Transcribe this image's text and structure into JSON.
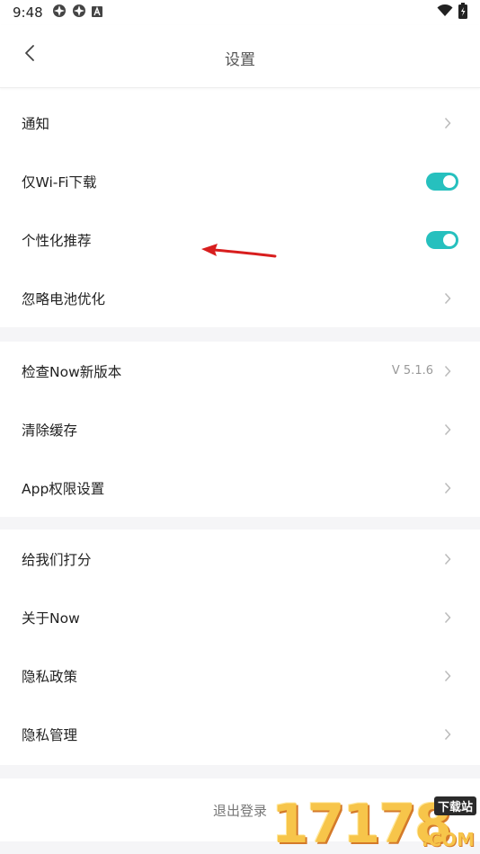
{
  "status_bar": {
    "time": "9:48",
    "icons": [
      "app-icon",
      "app-icon",
      "a-notification-icon"
    ],
    "right_icons": [
      "wifi-icon",
      "battery-icon"
    ]
  },
  "header": {
    "title": "设置",
    "back_icon": "back-chevron-icon"
  },
  "groups": [
    {
      "rows": [
        {
          "label": "通知",
          "trailing": "chevron"
        },
        {
          "label": "仅Wi-Fi下载",
          "trailing": "toggle",
          "on": true
        },
        {
          "label": "个性化推荐",
          "trailing": "toggle",
          "on": true
        },
        {
          "label": "忽略电池优化",
          "trailing": "chevron"
        }
      ]
    },
    {
      "rows": [
        {
          "label": "检查Now新版本",
          "trailing": "chevron",
          "value": "V 5.1.6"
        },
        {
          "label": "清除缓存",
          "trailing": "chevron"
        },
        {
          "label": "App权限设置",
          "trailing": "chevron"
        }
      ]
    },
    {
      "rows": [
        {
          "label": "给我们打分",
          "trailing": "chevron"
        },
        {
          "label": "关于Now",
          "trailing": "chevron"
        },
        {
          "label": "隐私政策",
          "trailing": "chevron"
        },
        {
          "label": "隐私管理",
          "trailing": "chevron"
        }
      ]
    }
  ],
  "logout_label": "退出登录",
  "colors": {
    "toggle_on": "#26c0be",
    "separator": "#f5f5f7",
    "annotation_arrow": "#d81e1e"
  },
  "watermark": {
    "digits": "17178",
    "tag": "下载站",
    "suffix": ".COM"
  }
}
